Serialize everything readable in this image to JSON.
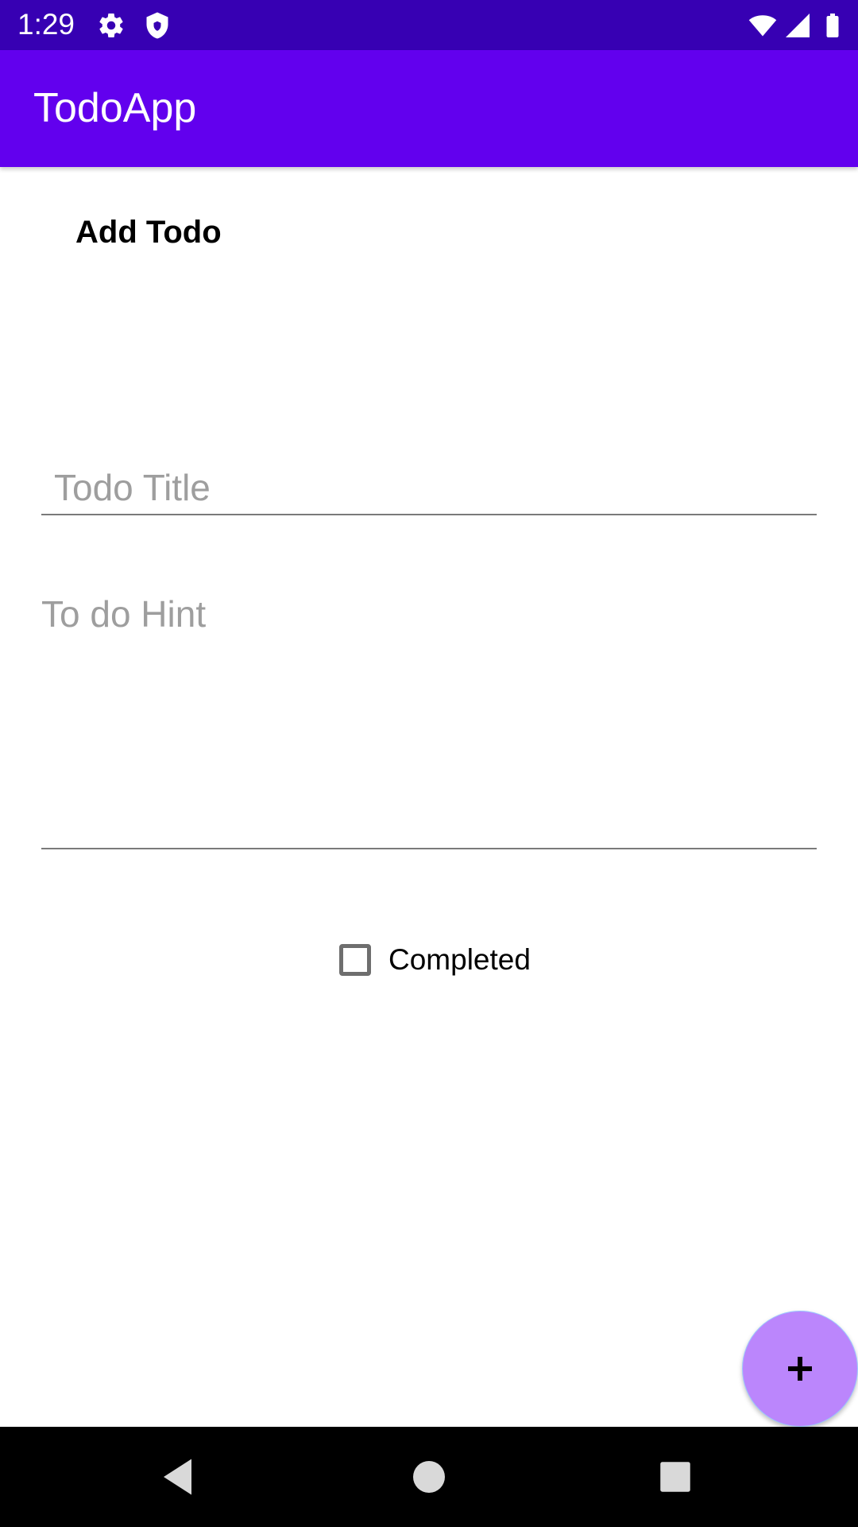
{
  "status_bar": {
    "time": "1:29",
    "icons": [
      "gear-icon",
      "shield-icon",
      "wifi-icon",
      "signal-icon",
      "battery-icon"
    ]
  },
  "app_bar": {
    "title": "TodoApp"
  },
  "form": {
    "heading": "Add Todo",
    "title_placeholder": "Todo Title",
    "title_value": "",
    "hint_placeholder": "To do Hint",
    "hint_value": "",
    "completed_label": "Completed",
    "completed_checked": false
  },
  "fab": {
    "icon": "plus-icon"
  },
  "nav_bar": {
    "buttons": [
      "back-icon",
      "home-icon",
      "recents-icon"
    ]
  },
  "colors": {
    "status_bar": "#3700b3",
    "app_bar": "#6200ee",
    "fab": "#bb86fc",
    "nav_bar": "#000000"
  }
}
